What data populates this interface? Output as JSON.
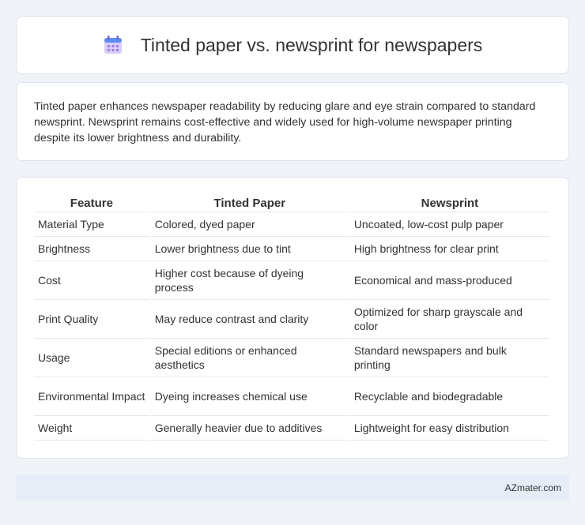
{
  "header": {
    "title": "Tinted paper vs. newsprint for newspapers",
    "icon": "calendar-icon",
    "icon_colors": {
      "body": "#cbb8f0",
      "top": "#5b8def",
      "grid": "#8c6fe0"
    }
  },
  "description": "Tinted paper enhances newspaper readability by reducing glare and eye strain compared to standard newsprint. Newsprint remains cost-effective and widely used for high-volume newspaper printing despite its lower brightness and durability.",
  "table": {
    "headers": [
      "Feature",
      "Tinted Paper",
      "Newsprint"
    ],
    "rows": [
      [
        "Material Type",
        "Colored, dyed paper",
        "Uncoated, low-cost pulp paper"
      ],
      [
        "Brightness",
        "Lower brightness due to tint",
        "High brightness for clear print"
      ],
      [
        "Cost",
        "Higher cost because of dyeing process",
        "Economical and mass-produced"
      ],
      [
        "Print Quality",
        "May reduce contrast and clarity",
        "Optimized for sharp grayscale and color"
      ],
      [
        "Usage",
        "Special editions or enhanced aesthetics",
        "Standard newspapers and bulk printing"
      ],
      [
        "Environmental Impact",
        "Dyeing increases chemical use",
        "Recyclable and biodegradable"
      ],
      [
        "Weight",
        "Generally heavier due to additives",
        "Lightweight for easy distribution"
      ]
    ]
  },
  "footer": {
    "brand": "AZmater.com"
  }
}
